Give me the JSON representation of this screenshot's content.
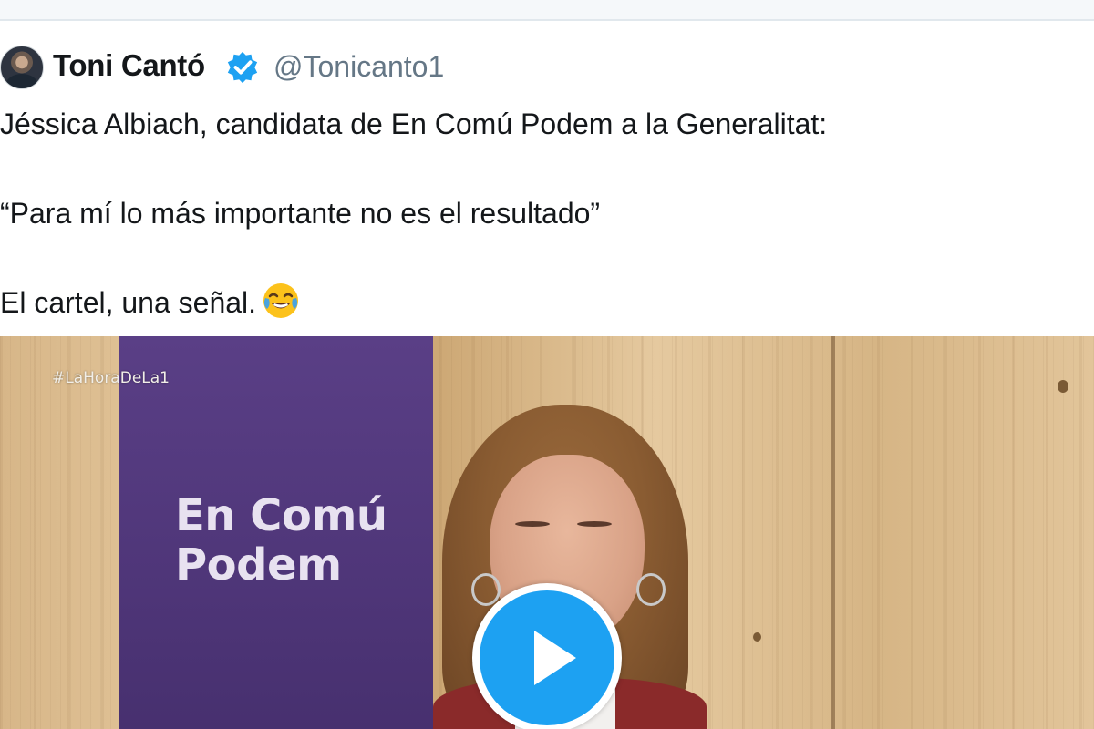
{
  "tweet": {
    "display_name": "Toni Cantó",
    "verified": true,
    "handle": "@Tonicanto1",
    "lines": [
      "Jéssica Albiach, candidata de En Comú Podem a la Generalitat:",
      "",
      "“Para mí lo más importante no es el resultado”",
      "",
      "El cartel, una señal."
    ],
    "emoji": "face-with-tears-of-joy"
  },
  "video": {
    "hashtag": "#LaHoraDeLa1",
    "banner_line_1": "En Comú",
    "banner_line_2": "Podem",
    "play_icon": "play-icon"
  },
  "colors": {
    "accent": "#1da1f2",
    "text": "#14171a",
    "secondary_text": "#657786",
    "banner": "#4f3679"
  }
}
